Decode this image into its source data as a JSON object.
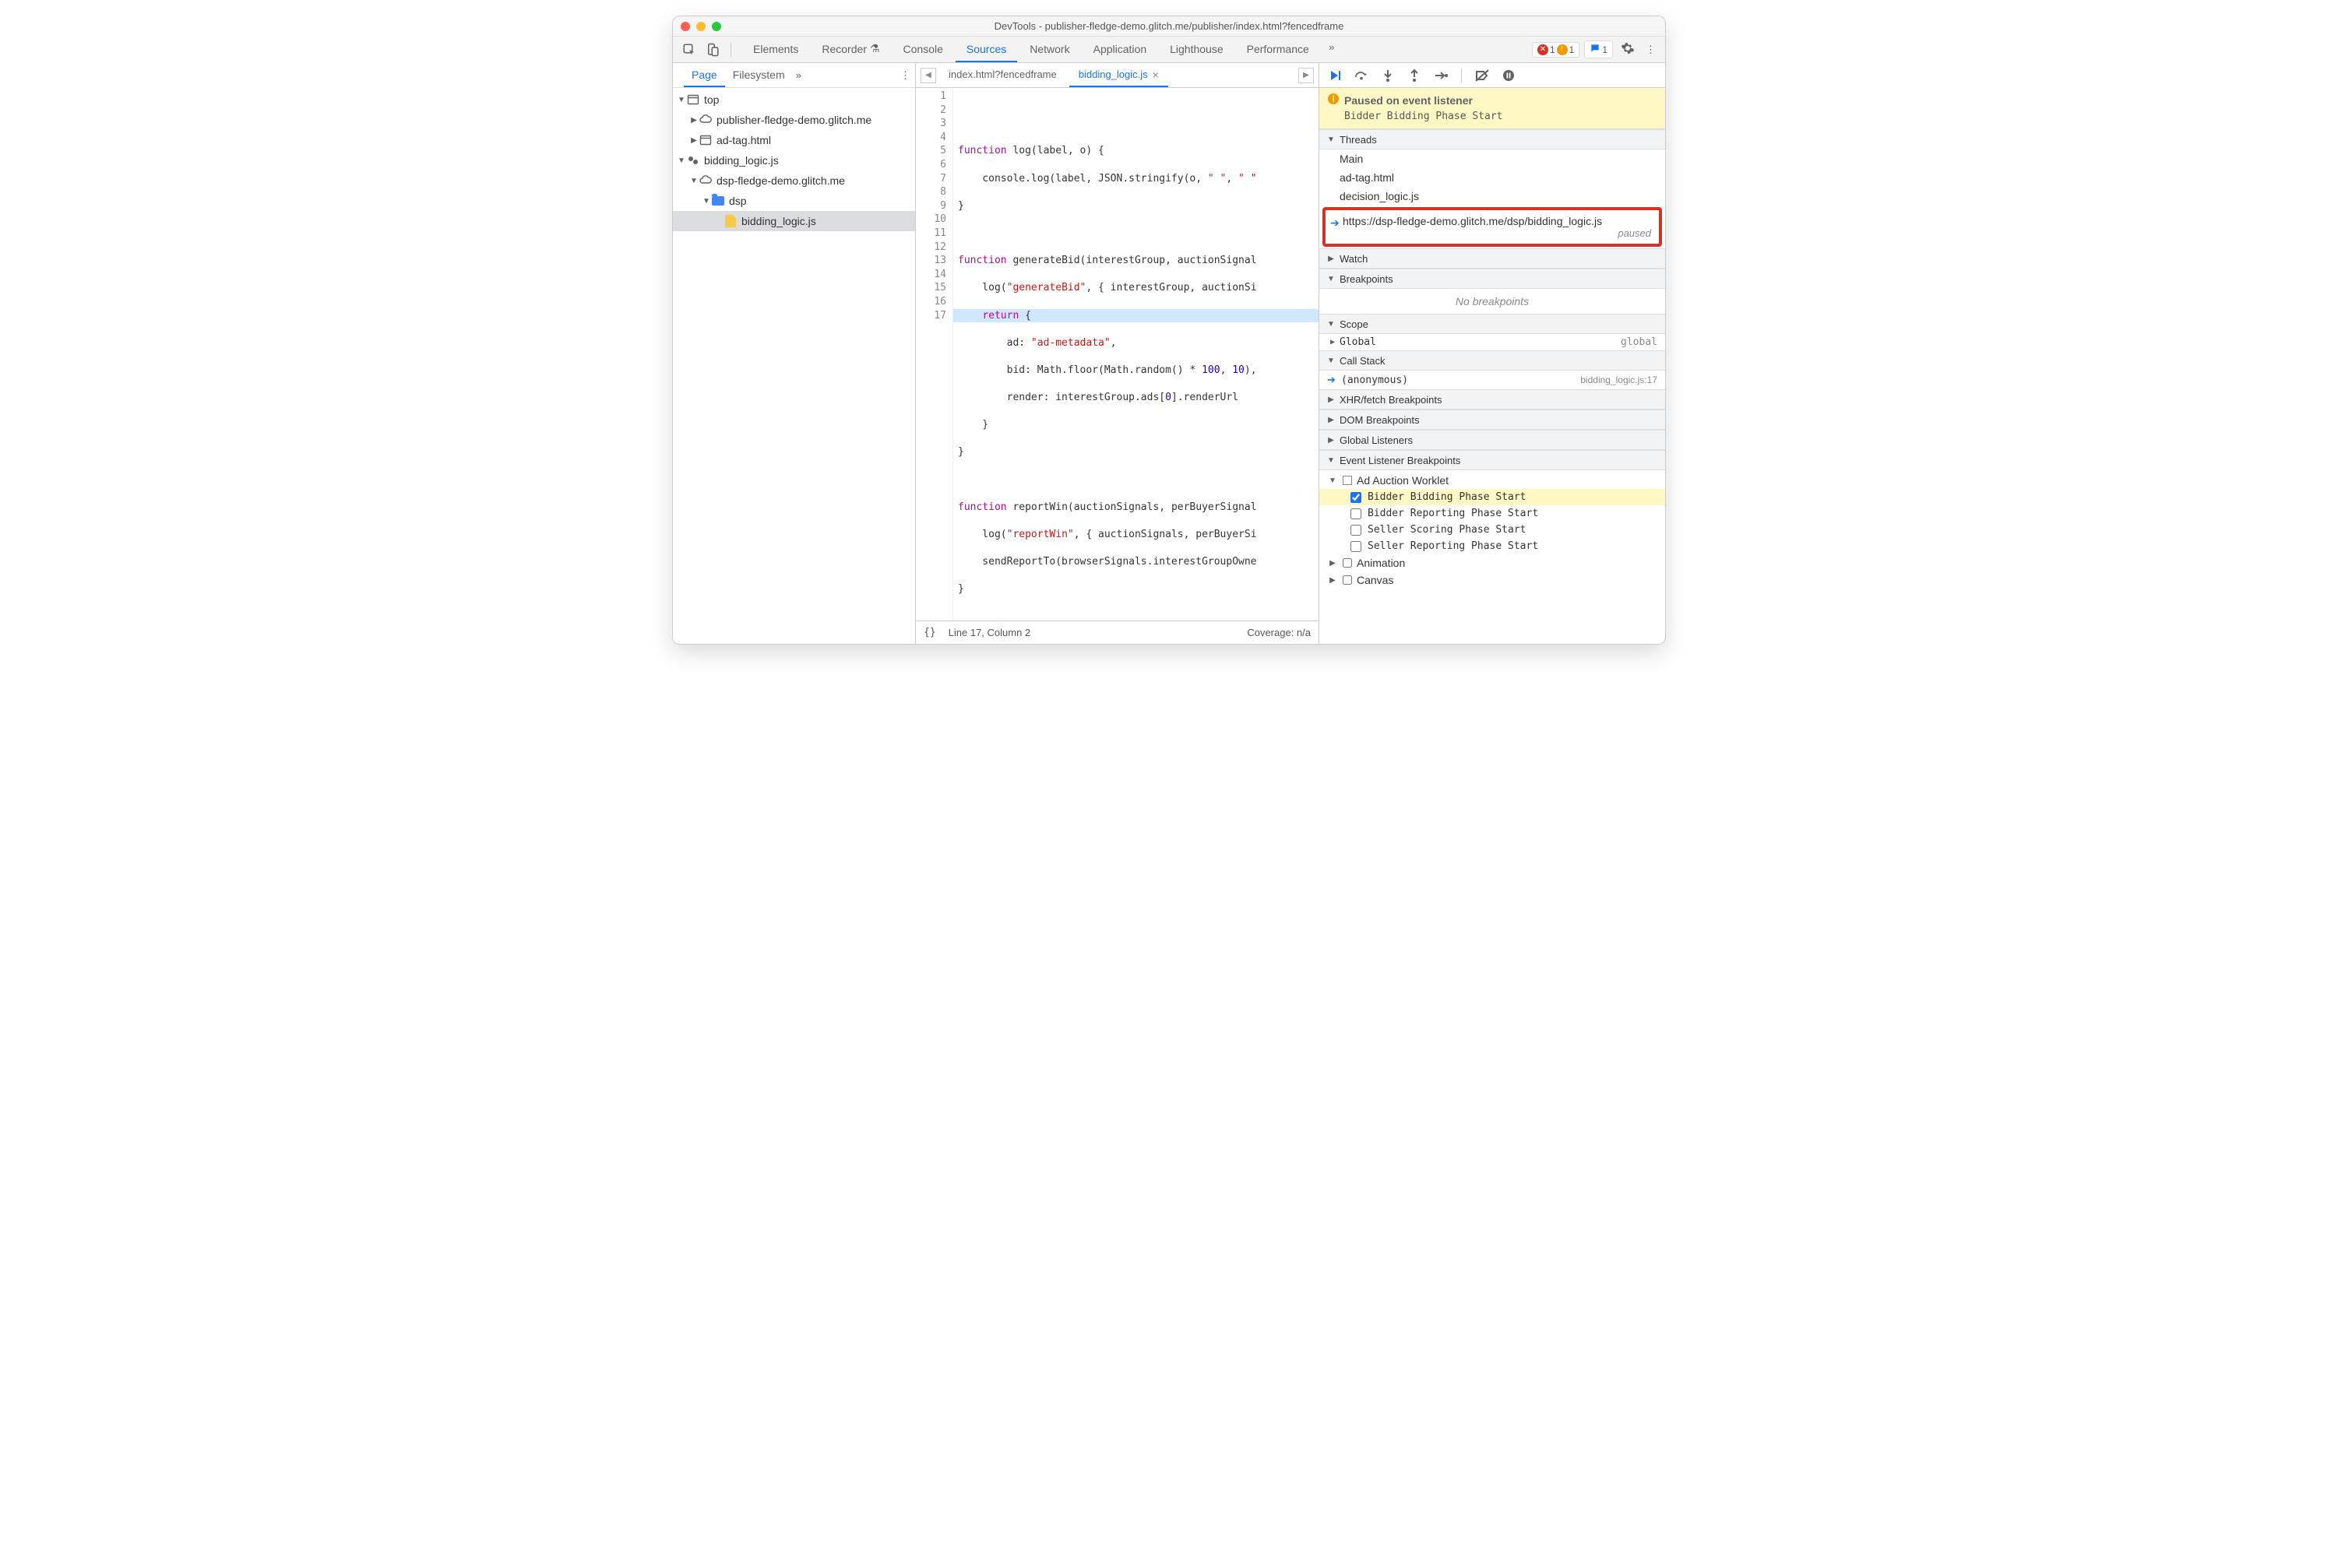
{
  "window": {
    "title": "DevTools - publisher-fledge-demo.glitch.me/publisher/index.html?fencedframe"
  },
  "main_tabs": {
    "items": [
      "Elements",
      "Recorder",
      "Console",
      "Sources",
      "Network",
      "Application",
      "Lighthouse",
      "Performance"
    ],
    "active": "Sources"
  },
  "toolbar_badges": {
    "errors": "1",
    "warnings": "1",
    "issues": "1"
  },
  "sidebar": {
    "tabs": {
      "page": "Page",
      "filesystem": "Filesystem"
    },
    "tree": {
      "top": "top",
      "pub": "publisher-fledge-demo.glitch.me",
      "adtag": "ad-tag.html",
      "bidding_root": "bidding_logic.js",
      "dsp_origin": "dsp-fledge-demo.glitch.me",
      "dsp_folder": "dsp",
      "bidding_file": "bidding_logic.js"
    }
  },
  "editor": {
    "tabs": {
      "t0": "index.html?fencedframe",
      "t1": "bidding_logic.js"
    },
    "gutter": [
      "1",
      "2",
      "3",
      "4",
      "5",
      "6",
      "7",
      "8",
      "9",
      "10",
      "11",
      "12",
      "13",
      "14",
      "15",
      "16",
      "17"
    ],
    "status": {
      "pos": "Line 17, Column 2",
      "coverage": "Coverage: n/a"
    }
  },
  "code": {
    "l1a": "function",
    "l1b": " log(label, o) {",
    "l2a": "    console.log(label, JSON.stringify(o, ",
    "l2b": "\" \"",
    "l2c": ", ",
    "l2d": "\" \"",
    "l3": "}",
    "l4": "",
    "l5a": "function",
    "l5b": " generateBid(interestGroup, auctionSignal",
    "l6a": "    log(",
    "l6b": "\"generateBid\"",
    "l6c": ", { interestGroup, auctionSi",
    "l7a": "    ",
    "l7b": "return",
    "l7c": " {",
    "l8a": "        ad: ",
    "l8b": "\"ad-metadata\"",
    "l8c": ",",
    "l9a": "        bid: Math.floor(Math.random() * ",
    "l9b": "100",
    "l9c": ", ",
    "l9d": "10",
    "l9e": "),",
    "l10": "        render: interestGroup.ads[",
    "l10b": "0",
    "l10c": "].renderUrl",
    "l11": "    }",
    "l12": "}",
    "l13": "",
    "l14a": "function",
    "l14b": " reportWin(auctionSignals, perBuyerSignal",
    "l15a": "    log(",
    "l15b": "\"reportWin\"",
    "l15c": ", { auctionSignals, perBuyerSi",
    "l16": "    sendReportTo(browserSignals.interestGroupOwne",
    "l17": "}"
  },
  "debugger": {
    "paused": {
      "title": "Paused on event listener",
      "reason": "Bidder Bidding Phase Start"
    },
    "sections": {
      "threads": "Threads",
      "watch": "Watch",
      "breakpoints": "Breakpoints",
      "scope": "Scope",
      "callstack": "Call Stack",
      "xhr": "XHR/fetch Breakpoints",
      "dom": "DOM Breakpoints",
      "global": "Global Listeners",
      "elb": "Event Listener Breakpoints"
    },
    "threads": {
      "main": "Main",
      "adtag": "ad-tag.html",
      "decision": "decision_logic.js",
      "bidding_url": "https://dsp-fledge-demo.glitch.me/dsp/bidding_logic.js",
      "paused_label": "paused"
    },
    "no_breakpoints": "No breakpoints",
    "scope": {
      "global_label": "Global",
      "global_val": "global"
    },
    "callstack": {
      "name": "(anonymous)",
      "loc": "bidding_logic.js:17"
    },
    "elb": {
      "group": "Ad Auction Worklet",
      "items": {
        "i0": "Bidder Bidding Phase Start",
        "i1": "Bidder Reporting Phase Start",
        "i2": "Seller Scoring Phase Start",
        "i3": "Seller Reporting Phase Start"
      },
      "animation": "Animation",
      "canvas": "Canvas"
    }
  }
}
